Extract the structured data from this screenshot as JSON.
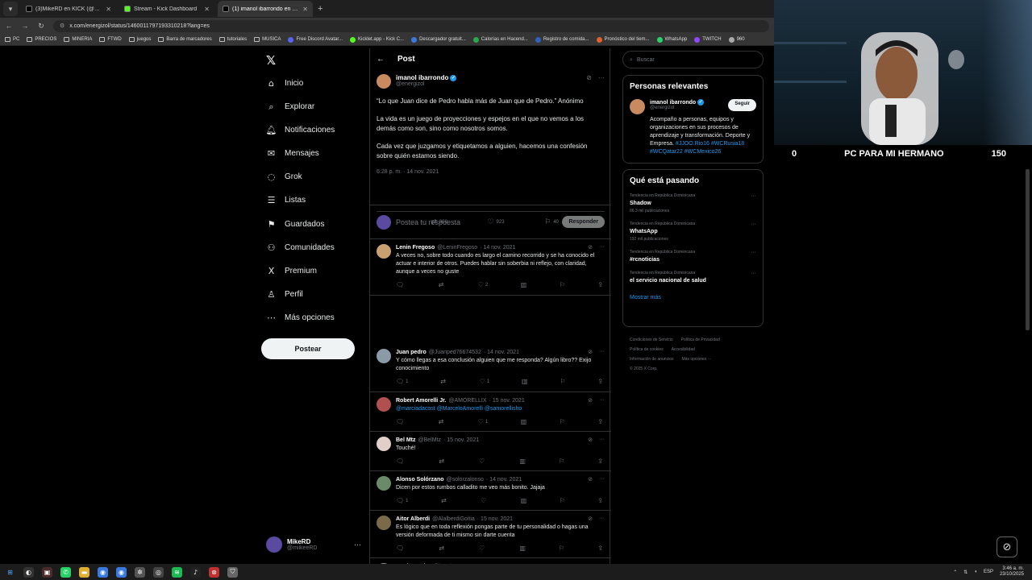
{
  "browser": {
    "tabs": [
      {
        "title": "(3)MikeRD en KICK (@miikeeRD",
        "active": false,
        "color": "#000000"
      },
      {
        "title": "Stream - Kick Dashboard",
        "active": false,
        "color": "#53fc18"
      },
      {
        "title": "(1) imanol ibarrondo en X: \"Lo",
        "active": true,
        "color": "#000000"
      }
    ],
    "url": "x.com/energizol/status/1460011797193310218?lang=es",
    "bookmarks": [
      "PC",
      "PRECIOS",
      "MINERIA",
      "FTWD",
      "juegos",
      "Barra de marcadores",
      "tutoriales",
      "MUSICA",
      "Free Discord Avatar...",
      "Kicklet.app - Kick C...",
      "Descargador gratuit...",
      "Calorías en Hacend...",
      "Registro de comida...",
      "Pronóstico del tiem...",
      "WhatsApp",
      "TWITCH",
      "960"
    ]
  },
  "sidebar": {
    "items": [
      {
        "label": "Inicio",
        "icon": "home-icon",
        "glyph": "⌂"
      },
      {
        "label": "Explorar",
        "icon": "search-icon",
        "glyph": "⌕"
      },
      {
        "label": "Notificaciones",
        "icon": "bell-icon",
        "glyph": "🔔︎"
      },
      {
        "label": "Mensajes",
        "icon": "envelope-icon",
        "glyph": "✉"
      },
      {
        "label": "Grok",
        "icon": "grok-icon",
        "glyph": "◌"
      },
      {
        "label": "Listas",
        "icon": "list-icon",
        "glyph": "☰"
      },
      {
        "label": "Guardados",
        "icon": "bookmark-icon",
        "glyph": "⚑"
      },
      {
        "label": "Comunidades",
        "icon": "people-icon",
        "glyph": "⚇"
      },
      {
        "label": "Premium",
        "icon": "x-icon",
        "glyph": "X"
      },
      {
        "label": "Perfil",
        "icon": "person-icon",
        "glyph": "♙"
      },
      {
        "label": "Más opciones",
        "icon": "more-icon",
        "glyph": "⋯"
      }
    ],
    "post_label": "Postear",
    "user": {
      "name": "MikeRD",
      "handle": "@miikeeRD"
    }
  },
  "post": {
    "header": "Post",
    "author": "imanol ibarrondo",
    "handle": "@energizol",
    "paragraphs": [
      "“Lo que Juan dice de Pedro habla más de Juan que de Pedro.” Anónimo",
      "La vida es un juego de proyecciones y espejos en el que no vemos a los demás como son, sino como nosotros somos.",
      "Cada vez que juzgamos y etiquetamos a alguien, hacemos una confesión sobre quién estamos siendo."
    ],
    "time": "6:28 p. m. · 14 nov. 2021",
    "stats": {
      "replies": "7",
      "reposts": "300",
      "likes": "923",
      "bookmarks": "40"
    },
    "reply_placeholder": "Postea tu respuesta",
    "reply_button": "Responder"
  },
  "replies": [
    {
      "name": "Lenin Fregoso",
      "handle": "@LeninFregoso",
      "date": "· 14 nov. 2021",
      "text": "A veces no, sobre todo cuando es largo el camino recorrido y se ha conocido el actuar e interior de otros. Puedes hablar sin soberbia ni reflejo, con claridad, aunque a veces no guste",
      "counts": {
        "reply": "",
        "repost": "",
        "like": "2"
      },
      "avatar": "#c9a070"
    },
    {
      "name": "Juan pedro",
      "handle": "@Juanped76674532",
      "date": "· 14 nov. 2021",
      "text": "Y cómo llegas a esa conclusión alguien que me responda? Algún libro?? Exijo conocimiento",
      "counts": {
        "reply": "1",
        "repost": "",
        "like": "1"
      },
      "avatar": "#8a9aa8"
    },
    {
      "name": "Robert Amorelli Jr.",
      "handle": "@AMORELLIX",
      "date": "· 15 nov. 2021",
      "text": "",
      "links": "@marciadacost @MarceloAmorelli @samorellisho",
      "counts": {
        "reply": "",
        "repost": "",
        "like": "1"
      },
      "avatar": "#b05050"
    },
    {
      "name": "Bel Mtz",
      "handle": "@BelMtz",
      "date": "· 15 nov. 2021",
      "text": "Touché!",
      "counts": {
        "reply": "",
        "repost": "",
        "like": ""
      },
      "avatar": "#e0d0c8"
    },
    {
      "name": "Alonso Solórzano",
      "handle": "@solorzalonso",
      "date": "· 14 nov. 2021",
      "text": "Dicen por estos rumbos calladito me veo más bonito. Jajaja",
      "counts": {
        "reply": "1",
        "repost": "",
        "like": ""
      },
      "avatar": "#6a8a6a"
    },
    {
      "name": "Aitor Alberdi",
      "handle": "@AlalberdiGoitia",
      "date": "· 15 nov. 2021",
      "text": "Es lógico que en toda reflexión pongas parte de tu personalidad o hagas una versión deformada de ti mismo sin darte cuenta",
      "counts": {
        "reply": "",
        "repost": "",
        "like": ""
      },
      "avatar": "#7a6a4a"
    },
    {
      "name": "José Sancho",
      "handle": "@jsmdev",
      "date": "· 15 nov. 2021",
      "text": "save",
      "links": "@readwiselo",
      "counts": {
        "reply": "1",
        "repost": "",
        "like": ""
      },
      "avatar": "#909090"
    }
  ],
  "right": {
    "search_placeholder": "Buscar",
    "relevant_title": "Personas relevantes",
    "relevant": {
      "name": "imanol ibarrondo",
      "handle": "@energizol",
      "follow": "Seguir",
      "bio": "Acompaño a personas, equipos y organizaciones en sus procesos de aprendizaje y transformación. Deporte y Empresa.",
      "tags": "#JJOO.Rio16 #WCRusia18 #WCQatar22 #WCMexico26"
    },
    "trends_title": "Qué está pasando",
    "trends": [
      {
        "context": "Tendencia en República Dominicana",
        "topic": "Shadow",
        "count": "86.3 mil publicaciones"
      },
      {
        "context": "Tendencia en República Dominicana",
        "topic": "WhatsApp",
        "count": "192 mil publicaciones"
      },
      {
        "context": "Tendencia en República Dominicana",
        "topic": "#rcnoticias",
        "count": ""
      },
      {
        "context": "Tendencia en República Dominicana",
        "topic": "el servicio nacional de salud",
        "count": ""
      }
    ],
    "show_more": "Mostrar más",
    "footer": [
      "Condiciones de Servicio",
      "Política de Privacidad",
      "Política de cookies",
      "Accesibilidad",
      "Información de anuncios",
      "Más opciones ···",
      "© 2025 X Corp."
    ]
  },
  "overlay": {
    "left": "0",
    "title": "PC PARA MI HERMANO",
    "right": "150"
  },
  "taskbar": {
    "lang": "ESP",
    "time": "3:46 a. m.",
    "date": "23/10/2025"
  }
}
